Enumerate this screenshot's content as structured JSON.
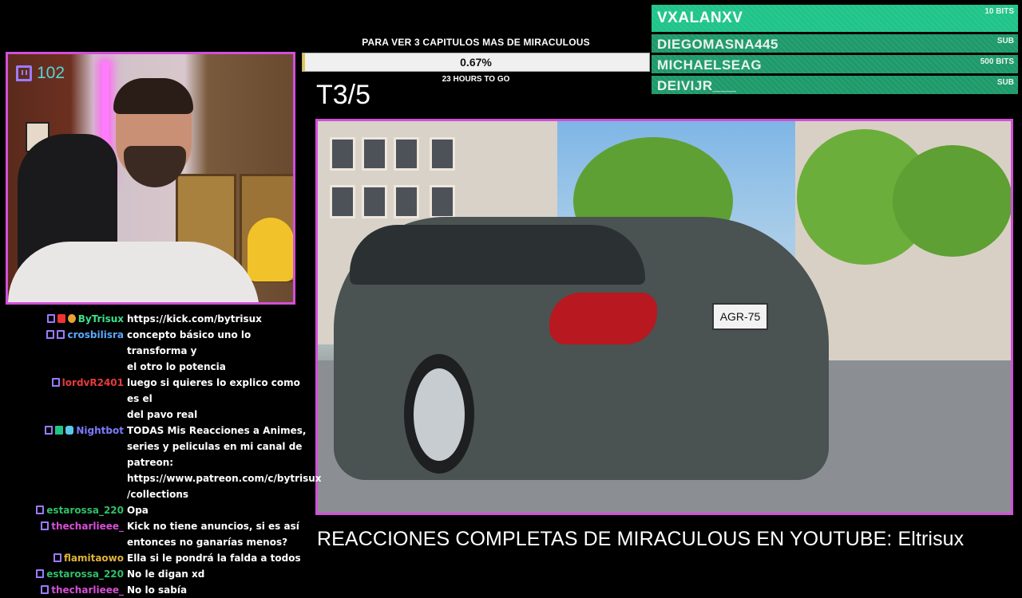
{
  "webcam": {
    "viewer_count": "102"
  },
  "goal": {
    "title": "PARA VER 3 CAPITULOS MAS DE MIRACULOUS",
    "percent_text": "0.67%",
    "progress_fraction": 0.0067,
    "time_left": "23 HOURS TO GO"
  },
  "episode_label": "T3/5",
  "alerts": [
    {
      "name": "VXALANXV",
      "type": "10 BITS"
    },
    {
      "name": "DIEGOMASNA445",
      "type": "SUB"
    },
    {
      "name": "MICHAELSEAG",
      "type": "500 BITS"
    },
    {
      "name": "DEIVIJR___",
      "type": "SUB"
    }
  ],
  "video": {
    "plate_text": "AGR-75"
  },
  "chat": [
    {
      "user": "ByTrisux",
      "color": "#3ee08a",
      "badges": [
        "sub",
        "red",
        "emo"
      ],
      "lines": [
        "https://kick.com/bytrisux"
      ]
    },
    {
      "user": "crosbilisra",
      "color": "#5aa8ff",
      "badges": [
        "sub",
        "sub"
      ],
      "lines": [
        "concepto básico uno lo transforma y",
        "el otro lo potencia"
      ]
    },
    {
      "user": "lordvR2401",
      "color": "#e83a3a",
      "badges": [
        "sub"
      ],
      "lines": [
        "luego si quieres lo explico como es el",
        "del pavo real"
      ]
    },
    {
      "user": "Nightbot",
      "color": "#7b7bff",
      "badges": [
        "sub",
        "chk",
        "bot"
      ],
      "lines": [
        "TODAS Mis Reacciones a Animes,",
        "series y peliculas en mi canal de",
        "patreon:",
        "https://www.patreon.com/c/bytrisux",
        "/collections"
      ]
    },
    {
      "user": "estarossa_220",
      "color": "#2fbf6a",
      "badges": [
        "sub"
      ],
      "lines": [
        "Opa"
      ]
    },
    {
      "user": "thecharlieee_",
      "color": "#d64fd8",
      "badges": [
        "sub"
      ],
      "lines": [
        "Kick no tiene anuncios, si es así",
        "entonces no ganarías menos?"
      ]
    },
    {
      "user": "flamitaowo",
      "color": "#e0b43a",
      "badges": [
        "sub"
      ],
      "lines": [
        "Ella si le pondrá la falda a todos"
      ]
    },
    {
      "user": "estarossa_220",
      "color": "#2fbf6a",
      "badges": [
        "sub"
      ],
      "lines": [
        "No le digan xd"
      ]
    },
    {
      "user": "thecharlieee_",
      "color": "#d64fd8",
      "badges": [
        "sub"
      ],
      "lines": [
        "No lo sabía"
      ]
    }
  ],
  "banner": "REACCIONES COMPLETAS DE MIRACULOUS EN YOUTUBE: Eltrisux"
}
